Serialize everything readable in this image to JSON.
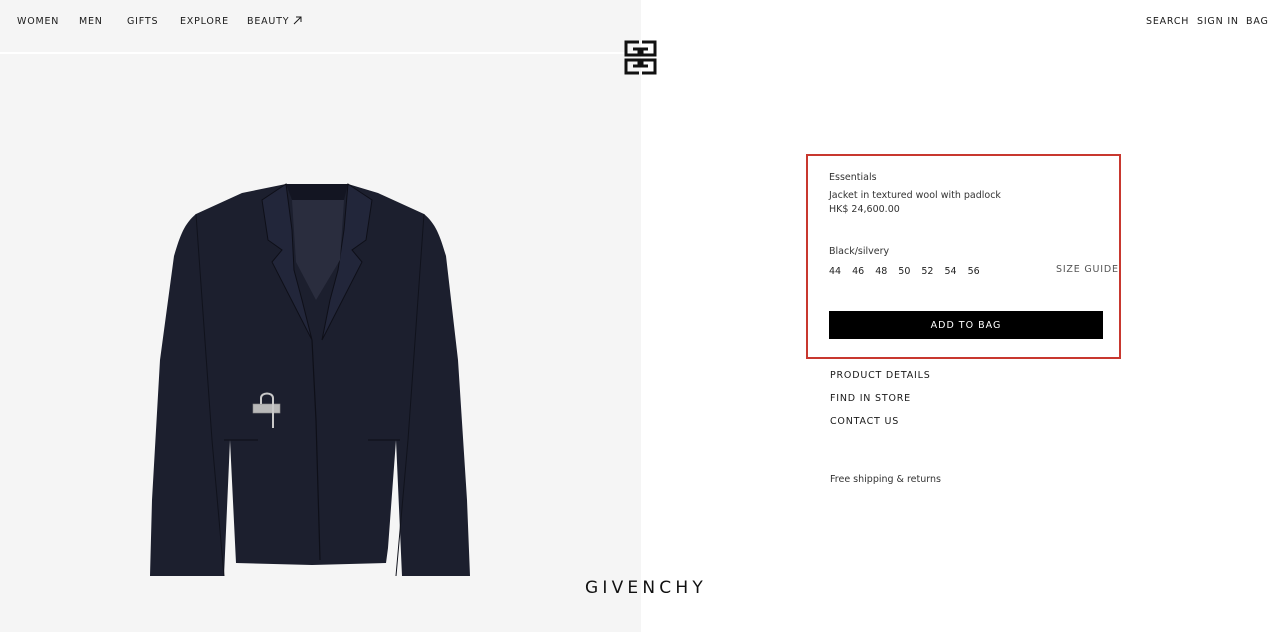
{
  "nav": {
    "left": [
      {
        "label": "WOMEN"
      },
      {
        "label": "MEN"
      },
      {
        "label": "GIFTS"
      },
      {
        "label": "EXPLORE"
      },
      {
        "label": "BEAUTY",
        "icon": "external-arrow-icon"
      }
    ],
    "right": {
      "search": "SEARCH",
      "sign_in": "SIGN IN",
      "bag": "BAG"
    }
  },
  "brand": {
    "logo_icon": "givenchy-4g-logo",
    "wordmark": "GIVENCHY"
  },
  "product": {
    "collection": "Essentials",
    "name": "Jacket in textured wool with padlock",
    "price": "HK$ 24,600.00",
    "color": "Black/silvery",
    "sizes": [
      "44",
      "46",
      "48",
      "50",
      "52",
      "54",
      "56"
    ],
    "size_guide": "SIZE GUIDE",
    "add_to_bag": "ADD TO BAG",
    "highlight_color": "#c8382f",
    "image_colors": {
      "jacket": "#1c1f2e",
      "padlock": "#b9b9b9"
    }
  },
  "links": {
    "product_details": "PRODUCT DETAILS",
    "find_in_store": "FIND IN STORE",
    "contact_us": "CONTACT US",
    "shipping": "Free shipping & returns"
  }
}
